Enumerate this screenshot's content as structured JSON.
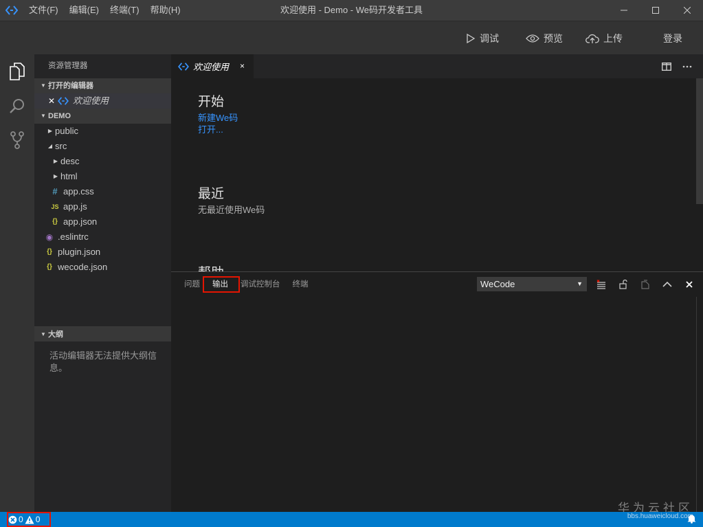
{
  "titlebar": {
    "title": "欢迎使用 - Demo - We码开发者工具",
    "menu": [
      "文件(F)",
      "编辑(E)",
      "终端(T)",
      "帮助(H)"
    ]
  },
  "toolbar": {
    "debug": "调试",
    "preview": "预览",
    "upload": "上传",
    "login": "登录"
  },
  "sidebar": {
    "title": "资源管理器",
    "open_editors": {
      "label": "打开的编辑器",
      "items": [
        {
          "label": "欢迎使用"
        }
      ]
    },
    "project": {
      "label": "DEMO",
      "items": [
        {
          "label": "public",
          "type": "folder",
          "expanded": false
        },
        {
          "label": "src",
          "type": "folder",
          "expanded": true
        },
        {
          "label": "desc",
          "type": "folder",
          "expanded": false
        },
        {
          "label": "html",
          "type": "folder",
          "expanded": false
        },
        {
          "label": "app.css",
          "type": "css"
        },
        {
          "label": "app.js",
          "type": "js"
        },
        {
          "label": "app.json",
          "type": "json"
        },
        {
          "label": ".eslintrc",
          "type": "eslint"
        },
        {
          "label": "plugin.json",
          "type": "json"
        },
        {
          "label": "wecode.json",
          "type": "json"
        }
      ]
    },
    "outline": {
      "label": "大纲",
      "message": "活动编辑器无法提供大纲信息。"
    }
  },
  "editor": {
    "tab": {
      "label": "欢迎使用",
      "close": "×"
    },
    "welcome": {
      "start_heading": "开始",
      "new_link": "新建We码",
      "open_link": "打开...",
      "recent_heading": "最近",
      "recent_empty": "无最近使用We码",
      "help_heading": "帮助"
    }
  },
  "panel": {
    "tabs": [
      "问题",
      "输出",
      "调试控制台",
      "终端"
    ],
    "active_tab": "输出",
    "channel": "WeCode"
  },
  "statusbar": {
    "errors": "0",
    "warnings": "0"
  },
  "watermark": {
    "main": "华为云社区",
    "sub": "bbs.huaweicloud.com"
  },
  "colors": {
    "accent": "#007acc",
    "link": "#3794ff",
    "highlight": "#e51400"
  }
}
